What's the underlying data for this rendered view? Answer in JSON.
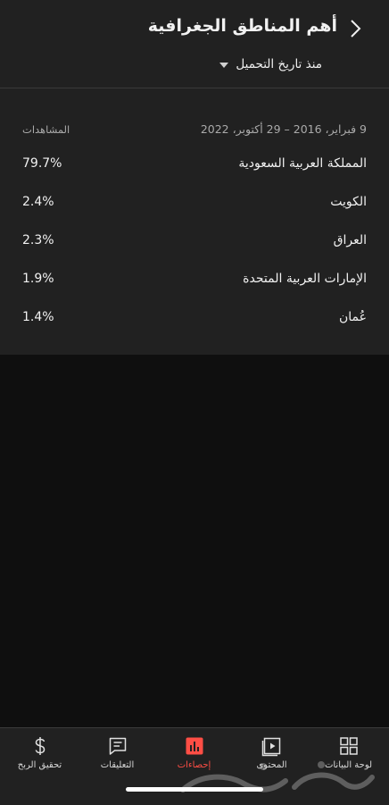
{
  "header": {
    "title": "أهم المناطق الجغرافية",
    "back_icon": "chevron-right-icon",
    "filter_label": "منذ تاريخ التحميل"
  },
  "report": {
    "date_range": "9 فبراير، 2016 – 29 أكتوبر، 2022",
    "column_header": "المشاهدات",
    "rows": [
      {
        "name": "المملكة العربية السعودية",
        "value": "79.7%"
      },
      {
        "name": "الكويت",
        "value": "2.4%"
      },
      {
        "name": "العراق",
        "value": "2.3%"
      },
      {
        "name": "الإمارات العربية المتحدة",
        "value": "1.9%"
      },
      {
        "name": "عُمان",
        "value": "1.4%"
      }
    ]
  },
  "bottom_nav": {
    "items": [
      {
        "label": "لوحة البيانات",
        "icon": "dashboard-icon",
        "active": false
      },
      {
        "label": "المحتوى",
        "icon": "content-icon",
        "active": false
      },
      {
        "label": "إحصاءات",
        "icon": "analytics-icon",
        "active": true
      },
      {
        "label": "التعليقات",
        "icon": "comments-icon",
        "active": false
      },
      {
        "label": "تحقيق الربح",
        "icon": "earn-icon",
        "active": false
      }
    ]
  },
  "colors": {
    "background": "#0f0f0f",
    "surface": "#212121",
    "accent": "#ff4e45",
    "secondary_text": "#aaaaaa"
  }
}
